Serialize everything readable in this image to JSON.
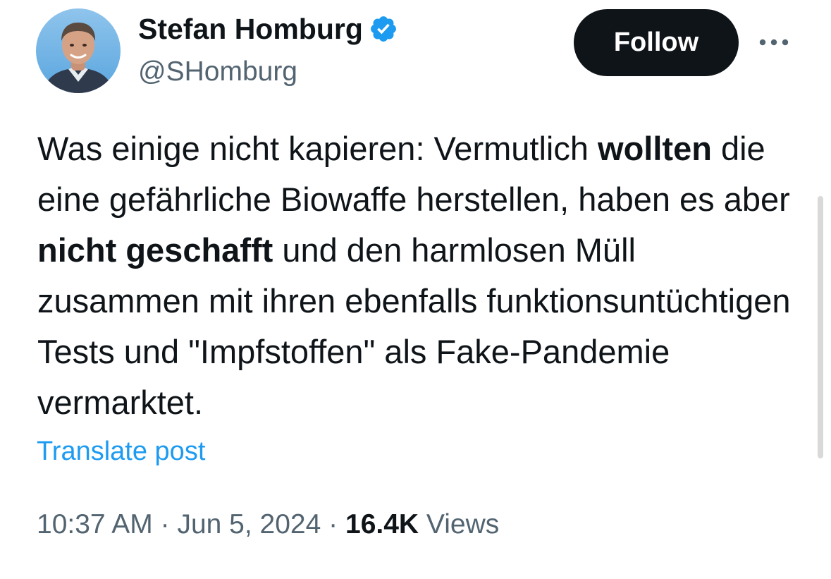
{
  "author": {
    "display_name": "Stefan Homburg",
    "handle": "@SHomburg",
    "avatar_icon": "person-portrait-avatar",
    "verified_icon": "verified-badge-icon",
    "verified_color": "#1d9bf0"
  },
  "actions": {
    "follow_label": "Follow",
    "more_icon": "more-dots-icon"
  },
  "post": {
    "text_segments": [
      {
        "text": "Was einige nicht kapieren: Vermutlich ",
        "bold": false
      },
      {
        "text": "wollten",
        "bold": true
      },
      {
        "text": " die eine gefährliche Biowaffe herstellen, haben es aber ",
        "bold": false
      },
      {
        "text": "nicht geschafft",
        "bold": true
      },
      {
        "text": " und den harmlosen Müll zusammen mit ihren ebenfalls funktionsuntüchtigen Tests und \"Impfstoffen\" als Fake-Pandemie vermarktet.",
        "bold": false
      }
    ],
    "translate_label": "Translate post"
  },
  "meta": {
    "time": "10:37 AM",
    "separator": "·",
    "date": "Jun 5, 2024",
    "views_count": "16.4K",
    "views_label": "Views"
  },
  "colors": {
    "text_primary": "#0f1419",
    "text_secondary": "#536471",
    "link": "#1d9bf0",
    "button_bg": "#0f1419",
    "button_text": "#ffffff"
  }
}
